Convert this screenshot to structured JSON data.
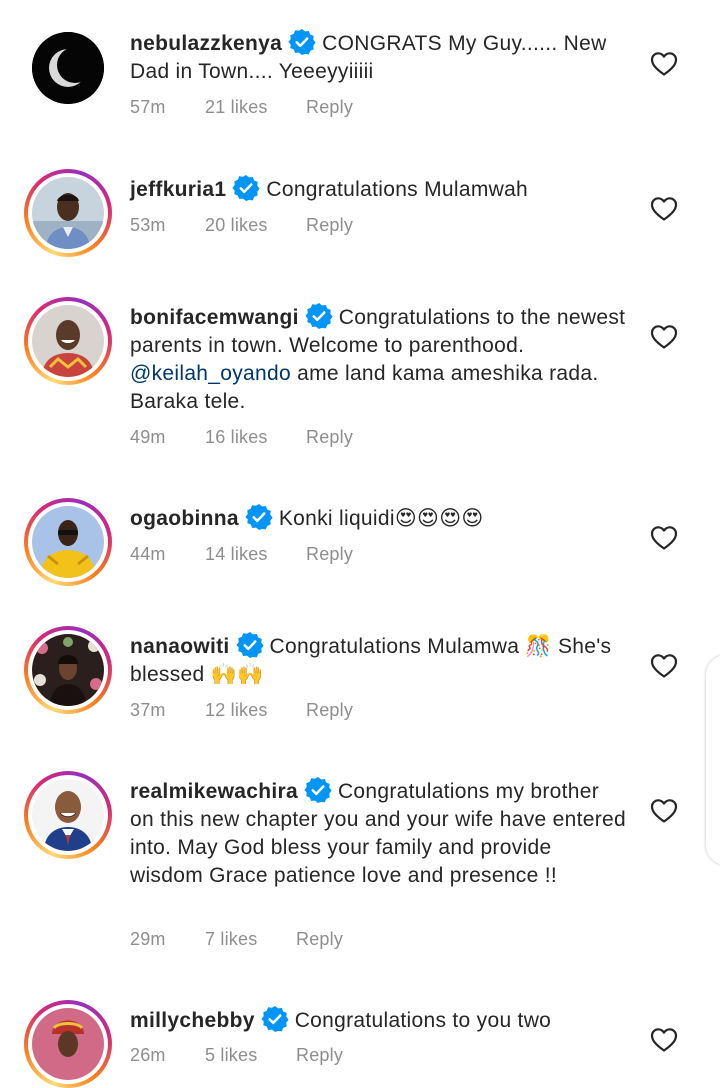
{
  "comments": [
    {
      "username": "nebulazzkenya",
      "text": "CONGRATS My Guy...... New Dad in Town.... Yeeeyyiiiii",
      "time": "57m",
      "likes": "21 likes",
      "reply": "Reply",
      "avatar": "moon-avatar"
    },
    {
      "username": "jeffkuria1",
      "text": "Congratulations Mulamwah",
      "time": "53m",
      "likes": "20 likes",
      "reply": "Reply",
      "avatar": "man-blue-shirt-avatar"
    },
    {
      "username": "bonifacemwangi",
      "text_before": "Congratulations to the newest parents in town. Welcome to parenthood. ",
      "mention": "@keilah_oyando",
      "text_after": " ame land kama ameshika rada. Baraka tele.",
      "time": "49m",
      "likes": "16 likes",
      "reply": "Reply",
      "avatar": "man-smiling-avatar"
    },
    {
      "username": "ogaobinna",
      "text": "Konki liquidi😍😍😍😍",
      "time": "44m",
      "likes": "14 likes",
      "reply": "Reply",
      "avatar": "man-yellow-outfit-avatar"
    },
    {
      "username": "nanaowiti",
      "text": "Congratulations Mulamwa 🎊 She's blessed 🙌🙌",
      "time": "37m",
      "likes": "12 likes",
      "reply": "Reply",
      "avatar": "woman-flowers-avatar"
    },
    {
      "username": "realmikewachira",
      "text": "Congratulations my brother on this new chapter you and your wife have entered into. May God bless your family and provide wisdom Grace patience love and presence !!",
      "time": "29m",
      "likes": "7 likes",
      "reply": "Reply",
      "avatar": "cartoon-man-suit-avatar"
    },
    {
      "username": "millychebby",
      "text": "Congratulations to you two",
      "time": "26m",
      "likes": "5 likes",
      "reply": "Reply",
      "avatar": "woman-headwrap-avatar"
    }
  ],
  "colors": {
    "verified": "#0095f6",
    "meta": "#8e8e8e",
    "mention": "#00376b",
    "text": "#262626"
  },
  "icons": {
    "verified": "verified-badge-icon",
    "like": "heart-outline-icon"
  }
}
